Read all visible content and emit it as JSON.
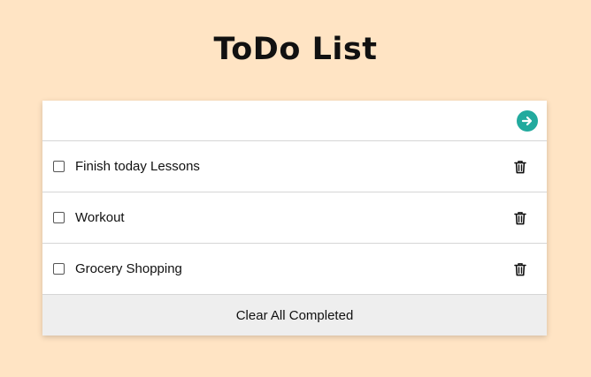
{
  "title": "ToDo List",
  "input": {
    "value": "",
    "placeholder": ""
  },
  "submit_icon": "arrow-right-circle-icon",
  "todos": [
    {
      "label": "Finish today Lessons",
      "completed": false
    },
    {
      "label": "Workout",
      "completed": false
    },
    {
      "label": "Grocery Shopping",
      "completed": false
    }
  ],
  "delete_icon": "trash-icon",
  "footer": {
    "clear_label": "Clear All Completed"
  },
  "colors": {
    "background": "#ffe4c4",
    "accent": "#22aa9e",
    "footer_bg": "#eeeeee"
  }
}
